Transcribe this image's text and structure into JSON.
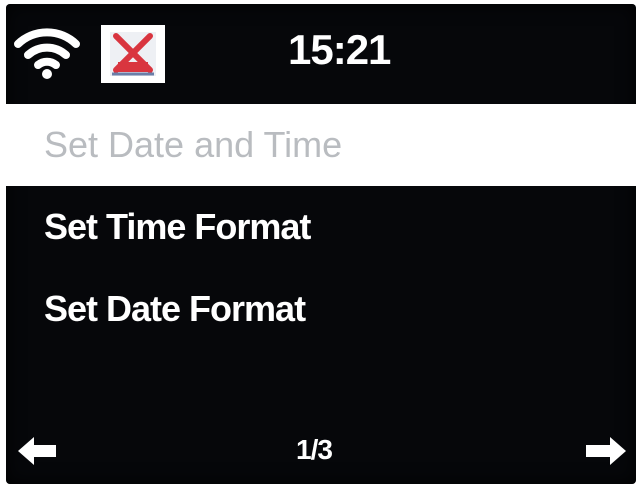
{
  "status_bar": {
    "time": "15:21",
    "wifi_icon": "wifi-icon",
    "mode_icon": "radio-station-icon"
  },
  "menu": {
    "items": [
      {
        "label": "Set Date and Time",
        "selected": true
      },
      {
        "label": "Set Time Format",
        "selected": false
      },
      {
        "label": "Set Date Format",
        "selected": false
      }
    ]
  },
  "footer": {
    "page": "1/3",
    "prev_icon": "arrow-left-icon",
    "next_icon": "arrow-right-icon"
  },
  "colors": {
    "background": "#06070a",
    "text": "#ffffff",
    "selected_bg": "#ffffff",
    "selected_text": "#b9bcc0",
    "icon_red": "#d9353f"
  }
}
